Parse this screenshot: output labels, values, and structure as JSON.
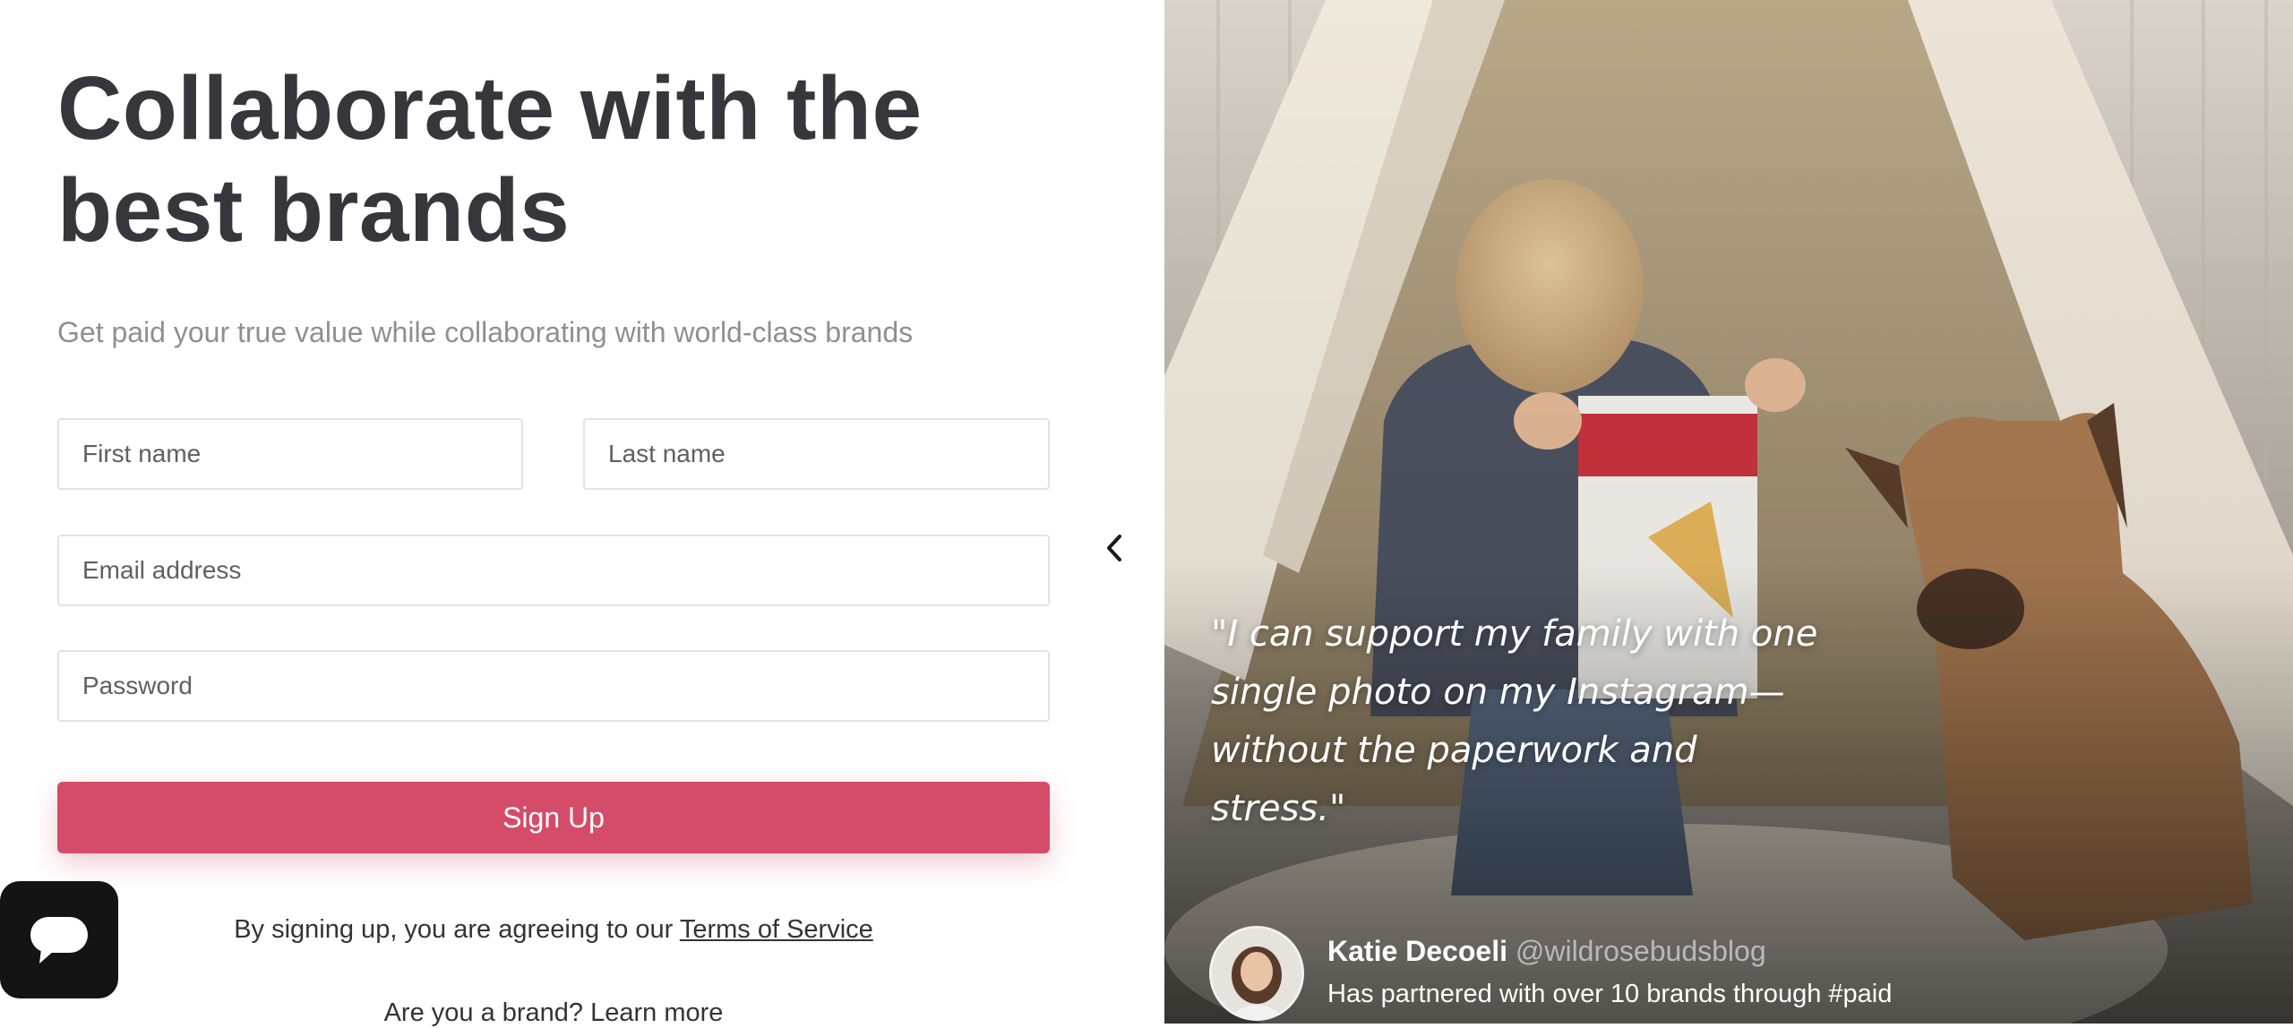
{
  "hero": {
    "headline_line1": "Collaborate with the",
    "headline_line2": "best brands",
    "subtitle": "Get paid your true value while collaborating with world-class brands"
  },
  "form": {
    "first_name_placeholder": "First name",
    "last_name_placeholder": "Last name",
    "email_placeholder": "Email address",
    "password_placeholder": "Password",
    "submit_label": "Sign Up",
    "terms_prefix": "By signing up, you are agreeing to our ",
    "terms_link": "Terms of Service",
    "brand_prompt": "Are you a brand? Learn more"
  },
  "testimonial": {
    "quote": "\"I can support my family with one single photo on my Instagram—without the paperwork and stress.\"",
    "author_name": "Katie Decoeli",
    "author_handle": "@wildrosebudsblog",
    "author_description": "Has partnered with over 10 brands through #paid"
  },
  "colors": {
    "accent": "#d44c69",
    "heading": "#36363c",
    "subtitle": "#8f8f93",
    "chat_widget": "#141414"
  },
  "icons": {
    "chat": "chat-bubble-icon",
    "carousel_prev": "chevron-left-icon"
  }
}
